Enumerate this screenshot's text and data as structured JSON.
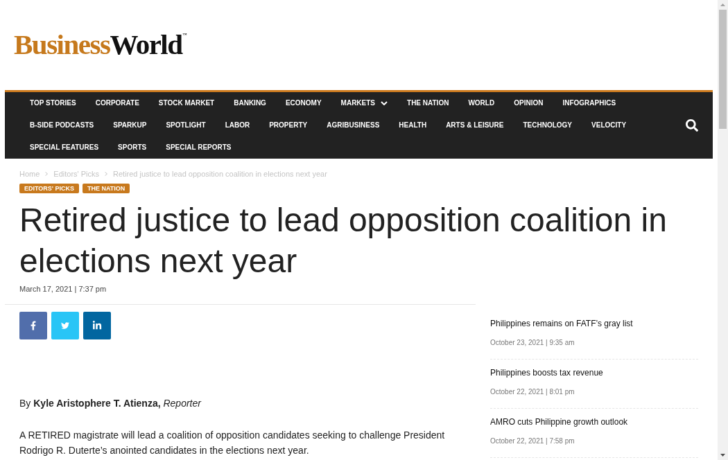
{
  "logo": {
    "business": "Business",
    "world": "World",
    "trademark": "™"
  },
  "nav": {
    "rows": [
      {
        "items": [
          {
            "label": "TOP STORIES",
            "dropdown": false
          },
          {
            "label": "CORPORATE",
            "dropdown": false
          },
          {
            "label": "STOCK MARKET",
            "dropdown": false
          },
          {
            "label": "BANKING",
            "dropdown": false
          },
          {
            "label": "ECONOMY",
            "dropdown": false
          },
          {
            "label": "MARKETS",
            "dropdown": true
          },
          {
            "label": "THE NATION",
            "dropdown": false
          },
          {
            "label": "WORLD",
            "dropdown": false
          },
          {
            "label": "OPINION",
            "dropdown": false
          },
          {
            "label": "INFOGRAPHICS",
            "dropdown": false
          }
        ]
      },
      {
        "items": [
          {
            "label": "B-SIDE PODCASTS",
            "dropdown": false
          },
          {
            "label": "SPARKUP",
            "dropdown": false
          },
          {
            "label": "SPOTLIGHT",
            "dropdown": false
          },
          {
            "label": "LABOR",
            "dropdown": false
          },
          {
            "label": "PROPERTY",
            "dropdown": false
          },
          {
            "label": "AGRIBUSINESS",
            "dropdown": false
          },
          {
            "label": "HEALTH",
            "dropdown": false
          },
          {
            "label": "ARTS & LEISURE",
            "dropdown": false
          },
          {
            "label": "TECHNOLOGY",
            "dropdown": false
          },
          {
            "label": "VELOCITY",
            "dropdown": false
          }
        ]
      },
      {
        "items": [
          {
            "label": "SPECIAL FEATURES",
            "dropdown": false
          },
          {
            "label": "SPORTS",
            "dropdown": false
          },
          {
            "label": "SPECIAL REPORTS",
            "dropdown": false
          }
        ]
      }
    ]
  },
  "breadcrumb": [
    "Home",
    "Editors' Picks",
    "Retired justice to lead opposition coalition in elections next year"
  ],
  "article": {
    "categories": [
      "EDITORS' PICKS",
      "THE NATION"
    ],
    "title": "Retired justice to lead opposition coalition in elections next year",
    "date": "March 17, 2021 | 7:37 pm",
    "share_buttons": [
      {
        "kind": "facebook",
        "color": "#516eab"
      },
      {
        "kind": "twitter",
        "color": "#29c5f6"
      },
      {
        "kind": "linkedin",
        "color": "#0266a0"
      }
    ],
    "byline": "By **Kyle Aristophere T. Atienza,** *Reporter*",
    "paragraphs": [
      "A RETIRED magistrate will lead a coalition of opposition candidates seeking to challenge President Rodrigo R. Duterte’s anointed candidates in the elections next year."
    ]
  },
  "sidebar": {
    "items": [
      {
        "title": "Philippines remains on FATF’s gray list",
        "date": "October 23, 2021 | 9:35 am"
      },
      {
        "title": "Philippines boosts tax revenue",
        "date": "October 22, 2021 | 8:01 pm"
      },
      {
        "title": "AMRO cuts Philippine growth outlook",
        "date": "October 22, 2021 | 7:58 pm"
      }
    ]
  }
}
